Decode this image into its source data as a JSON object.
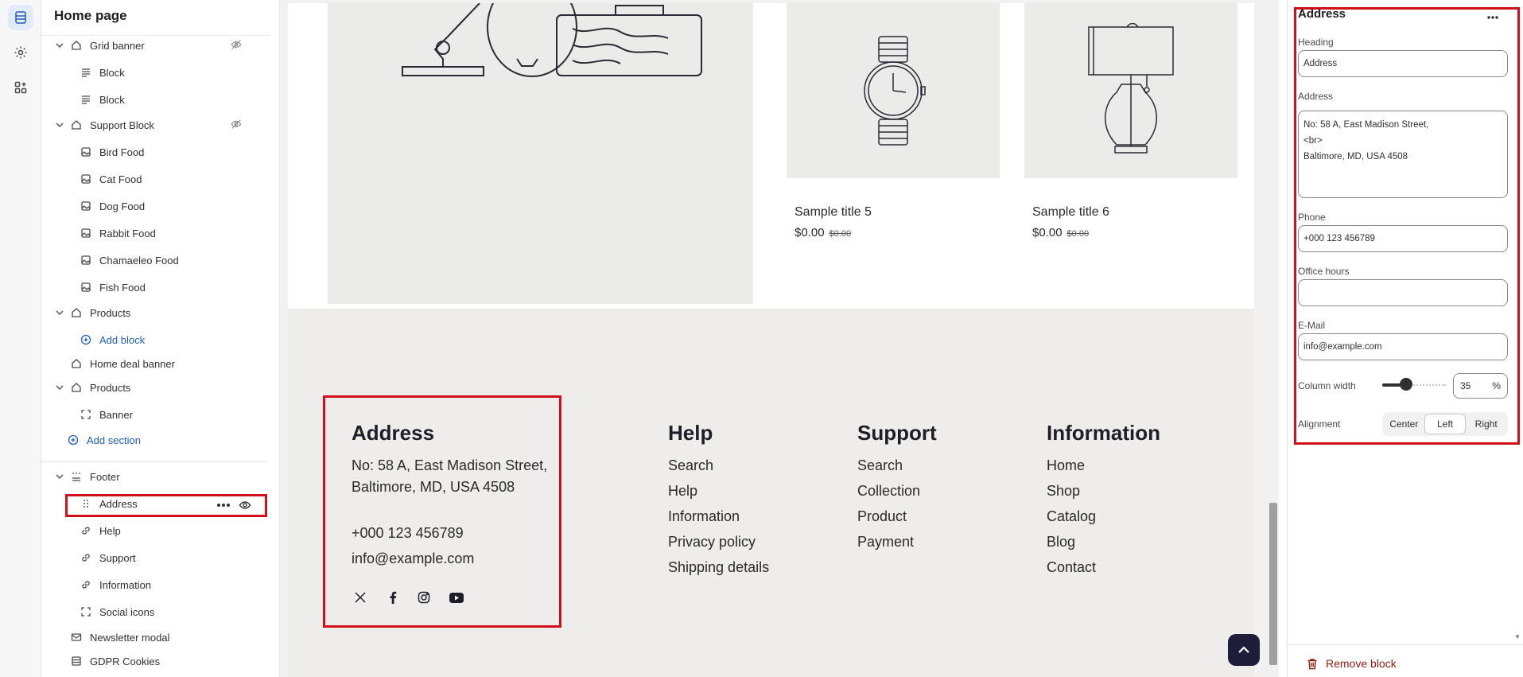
{
  "sidebar": {
    "title": "Home page",
    "items": [
      {
        "label": "Grid banner"
      },
      {
        "label": "Block"
      },
      {
        "label": "Block"
      },
      {
        "label": "Support Block"
      },
      {
        "label": "Bird Food"
      },
      {
        "label": "Cat Food"
      },
      {
        "label": "Dog Food"
      },
      {
        "label": "Rabbit Food"
      },
      {
        "label": "Chamaeleo Food"
      },
      {
        "label": "Fish Food"
      },
      {
        "label": "Products"
      },
      {
        "label": "Add block"
      },
      {
        "label": "Home deal banner"
      },
      {
        "label": "Products"
      },
      {
        "label": "Banner"
      },
      {
        "label": "Add section"
      },
      {
        "label": "Footer"
      },
      {
        "label": "Address"
      },
      {
        "label": "Help"
      },
      {
        "label": "Support"
      },
      {
        "label": "Information"
      },
      {
        "label": "Social icons"
      },
      {
        "label": "Newsletter modal"
      },
      {
        "label": "GDPR Cookies"
      }
    ]
  },
  "preview": {
    "cards": [
      {
        "title": "Sample title 5",
        "price": "$0.00",
        "compare": "$0.00"
      },
      {
        "title": "Sample title 6",
        "price": "$0.00",
        "compare": "$0.00"
      }
    ],
    "footer": {
      "address": {
        "heading": "Address",
        "line1": "No: 58 A, East Madison Street,",
        "line2": "Baltimore, MD, USA 4508",
        "phone": "+000 123 456789",
        "email": "info@example.com"
      },
      "columns": [
        {
          "heading": "Help",
          "links": [
            "Search",
            "Help",
            "Information",
            "Privacy policy",
            "Shipping details"
          ]
        },
        {
          "heading": "Support",
          "links": [
            "Search",
            "Collection",
            "Product",
            "Payment"
          ]
        },
        {
          "heading": "Information",
          "links": [
            "Home",
            "Shop",
            "Catalog",
            "Blog",
            "Contact"
          ]
        }
      ],
      "social_icons": [
        "x-twitter-icon",
        "facebook-icon",
        "instagram-icon",
        "youtube-icon"
      ]
    }
  },
  "settings": {
    "title": "Address",
    "heading_label": "Heading",
    "heading_value": "Address",
    "address_label": "Address",
    "address_value": "No: 58 A, East Madison Street,\n<br>\nBaltimore, MD, USA 4508",
    "phone_label": "Phone",
    "phone_value": "+000 123 456789",
    "office_hours_label": "Office hours",
    "office_hours_value": "",
    "email_label": "E-Mail",
    "email_value": "info@example.com",
    "column_width_label": "Column width",
    "column_width_value": "35",
    "column_width_unit": "%",
    "column_width_fraction": 0.35,
    "alignment_label": "Alignment",
    "alignment_options": [
      "Center",
      "Left",
      "Right"
    ],
    "alignment_selected": "Left",
    "remove_label": "Remove block"
  },
  "colors": {
    "highlight": "#d40f1c",
    "link": "#1f5eb9",
    "danger": "#8e1f0b",
    "footer_bg": "#eeedec"
  }
}
